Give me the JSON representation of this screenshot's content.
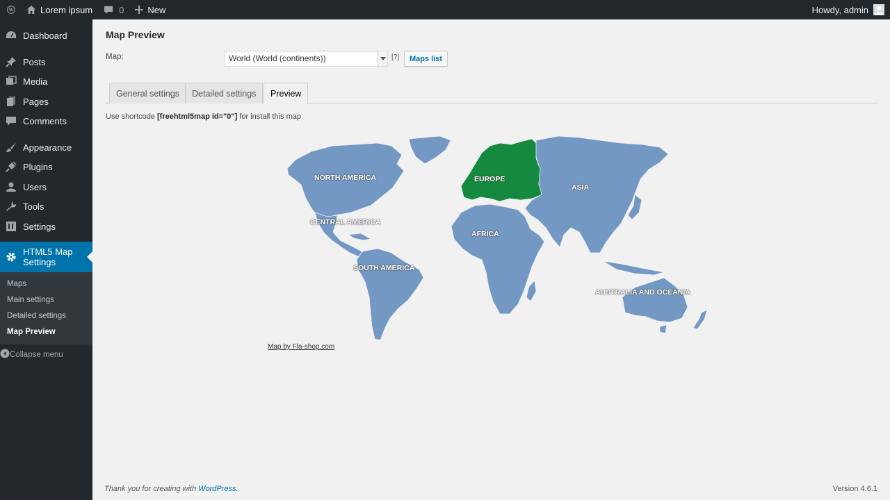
{
  "adminbar": {
    "site_name": "Lorem ipsum",
    "comments_count": "0",
    "new_label": "New",
    "greeting": "Howdy, admin"
  },
  "sidebar": {
    "items": [
      {
        "label": "Dashboard",
        "icon": "dashboard-icon"
      },
      {
        "label": "Posts",
        "icon": "pin-icon"
      },
      {
        "label": "Media",
        "icon": "media-icon"
      },
      {
        "label": "Pages",
        "icon": "pages-icon"
      },
      {
        "label": "Comments",
        "icon": "comment-icon"
      },
      {
        "label": "Appearance",
        "icon": "brush-icon"
      },
      {
        "label": "Plugins",
        "icon": "plug-icon"
      },
      {
        "label": "Users",
        "icon": "user-icon"
      },
      {
        "label": "Tools",
        "icon": "wrench-icon"
      },
      {
        "label": "Settings",
        "icon": "settings-icon"
      }
    ],
    "current": {
      "label_line1": "HTML5 Map",
      "label_line2": "Settings",
      "icon": "gear-icon"
    },
    "submenu": [
      "Maps",
      "Main settings",
      "Detailed settings",
      "Map Preview"
    ],
    "collapse_label": "Collapse menu"
  },
  "page": {
    "title": "Map Preview",
    "map_label": "Map:",
    "map_select_value": "World (World (continents))",
    "help_label": "[?]",
    "maps_list_button": "Maps list",
    "tabs": [
      "General settings",
      "Detailed settings",
      "Preview"
    ],
    "active_tab": "Preview",
    "shortcode_prefix": "Use shortcode",
    "shortcode": "[freehtml5map id=\"0\"]",
    "shortcode_suffix": "for install this map"
  },
  "map": {
    "highlight_color": "#15893e",
    "base_color": "#7498c4",
    "labels": {
      "north_america": "NORTH AMERICA",
      "central_america": "CENTRAL AMERICA",
      "south_america": "SOUTH AMERICA",
      "europe": "EUROPE",
      "africa": "AFRICA",
      "asia": "ASIA",
      "australia": "AUSTRALIA AND OCEANIA"
    },
    "highlighted": "EUROPE",
    "credit": "Map by Fla-shop.com"
  },
  "footer": {
    "thanks_prefix": "Thank you for creating with",
    "wp_link": "WordPress",
    "version": "Version 4.6.1"
  }
}
